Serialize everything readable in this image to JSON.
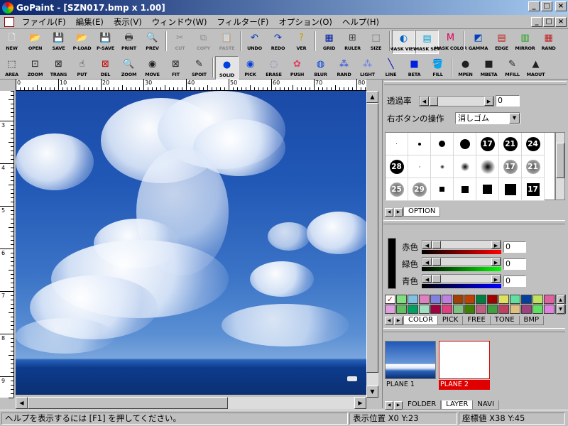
{
  "window": {
    "title": "GoPaint - [SZN017.bmp x 1.00]",
    "controls": {
      "minimize": "_",
      "maximize": "□",
      "close": "×"
    }
  },
  "menubar": {
    "items": [
      "ファイル(F)",
      "編集(E)",
      "表示(V)",
      "ウィンドウ(W)",
      "フィルター(F)",
      "オプション(O)",
      "ヘルプ(H)"
    ]
  },
  "toolbar1": {
    "groups": [
      [
        {
          "label": "NEW",
          "icon": "new-icon",
          "glyph": "🗋",
          "color": "#ffffff",
          "disabled": false
        },
        {
          "label": "OPEN",
          "icon": "open-icon",
          "glyph": "📂",
          "color": "#e0c040",
          "disabled": false
        },
        {
          "label": "SAVE",
          "icon": "save-icon",
          "glyph": "💾",
          "color": "#202020",
          "disabled": false
        },
        {
          "label": "P-LOAD",
          "icon": "palette-load-icon",
          "glyph": "📂",
          "color": "#e0c040",
          "disabled": false
        },
        {
          "label": "P-SAVE",
          "icon": "palette-save-icon",
          "glyph": "💾",
          "color": "#202020",
          "disabled": false
        },
        {
          "label": "PRINT",
          "icon": "print-icon",
          "glyph": "🖶",
          "color": "#404040",
          "disabled": false
        },
        {
          "label": "PREV",
          "icon": "preview-icon",
          "glyph": "🔍",
          "color": "#404040",
          "disabled": false
        }
      ],
      [
        {
          "label": "CUT",
          "icon": "cut-icon",
          "glyph": "✂",
          "color": "#404040",
          "disabled": true
        },
        {
          "label": "COPY",
          "icon": "copy-icon",
          "glyph": "⧉",
          "color": "#404040",
          "disabled": true
        },
        {
          "label": "PASTE",
          "icon": "paste-icon",
          "glyph": "📋",
          "color": "#404040",
          "disabled": true
        }
      ],
      [
        {
          "label": "UNDO",
          "icon": "undo-icon",
          "glyph": "↶",
          "color": "#0030c0",
          "disabled": false
        },
        {
          "label": "REDO",
          "icon": "redo-icon",
          "glyph": "↷",
          "color": "#0030c0",
          "disabled": false
        },
        {
          "label": "VER",
          "icon": "version-icon",
          "glyph": "?",
          "color": "#c0a000",
          "disabled": false
        }
      ],
      [
        {
          "label": "GRID",
          "icon": "grid-icon",
          "glyph": "▦",
          "color": "#0020a0",
          "disabled": false
        },
        {
          "label": "RULER",
          "icon": "ruler-icon",
          "glyph": "⊞",
          "color": "#404040",
          "disabled": false
        },
        {
          "label": "SIZE",
          "icon": "size-icon",
          "glyph": "⬚",
          "color": "#404040",
          "disabled": false
        }
      ],
      [
        {
          "label": "MASK VIEW",
          "icon": "mask-view-icon",
          "glyph": "◐",
          "color": "#0060c0",
          "disabled": false,
          "active": true
        },
        {
          "label": "MASK SET",
          "icon": "mask-set-icon",
          "glyph": "▤",
          "color": "#00a0d0",
          "disabled": false,
          "active": true
        },
        {
          "label": "MASK COLOR",
          "icon": "mask-color-icon",
          "glyph": "M",
          "color": "#e00060",
          "disabled": false
        }
      ],
      [
        {
          "label": "GAMMA",
          "icon": "gamma-icon",
          "glyph": "◩",
          "color": "#0040c0",
          "disabled": false
        },
        {
          "label": "EDGE",
          "icon": "edge-icon",
          "glyph": "▤",
          "color": "#c02020",
          "disabled": false
        },
        {
          "label": "MIRROR",
          "icon": "mirror-icon",
          "glyph": "▥",
          "color": "#20a020",
          "disabled": false
        },
        {
          "label": "RAND",
          "icon": "random-icon",
          "glyph": "▦",
          "color": "#c02020",
          "disabled": false
        }
      ]
    ]
  },
  "toolbar2": {
    "groups": [
      [
        {
          "label": "AREA",
          "icon": "area-select-icon",
          "glyph": "⬚",
          "color": "#202020"
        },
        {
          "label": "ZOOM",
          "icon": "zoom-area-icon",
          "glyph": "⊡",
          "color": "#202020"
        },
        {
          "label": "TRANS",
          "icon": "transform-icon",
          "glyph": "⊠",
          "color": "#202020"
        },
        {
          "label": "PUT",
          "icon": "put-icon",
          "glyph": "☝",
          "color": "#202020"
        },
        {
          "label": "DEL",
          "icon": "delete-icon",
          "glyph": "⊠",
          "color": "#c00000"
        },
        {
          "label": "ZOOM",
          "icon": "zoom-icon",
          "glyph": "🔍",
          "color": "#202020"
        },
        {
          "label": "MOVE",
          "icon": "move-icon",
          "glyph": "◉",
          "color": "#202020"
        },
        {
          "label": "FIT",
          "icon": "fit-icon",
          "glyph": "⊠",
          "color": "#202020"
        },
        {
          "label": "SPOIT",
          "icon": "eyedropper-icon",
          "glyph": "✎",
          "color": "#202020"
        }
      ],
      [
        {
          "label": "SOLID",
          "icon": "solid-brush-icon",
          "glyph": "●",
          "color": "#0040e0",
          "active": true
        },
        {
          "label": "PICK",
          "icon": "pick-brush-icon",
          "glyph": "◉",
          "color": "#0040e0"
        },
        {
          "label": "ERASE",
          "icon": "erase-brush-icon",
          "glyph": "◌",
          "color": "#6080c0"
        },
        {
          "label": "PUSH",
          "icon": "push-brush-icon",
          "glyph": "✿",
          "color": "#e04060"
        },
        {
          "label": "BLUR",
          "icon": "blur-brush-icon",
          "glyph": "◍",
          "color": "#0040e0"
        },
        {
          "label": "RAND",
          "icon": "random-brush-icon",
          "glyph": "⁂",
          "color": "#2040e0"
        },
        {
          "label": "LIGHT",
          "icon": "light-brush-icon",
          "glyph": "⁂",
          "color": "#6080e0"
        },
        {
          "label": "LINE",
          "icon": "line-icon",
          "glyph": "╲",
          "color": "#0000c0"
        },
        {
          "label": "BETA",
          "icon": "beta-fill-icon",
          "glyph": "■",
          "color": "#0020e0"
        },
        {
          "label": "FILL",
          "icon": "fill-icon",
          "glyph": "🪣",
          "color": "#0020a0"
        }
      ],
      [
        {
          "label": "MPEN",
          "icon": "mask-pen-icon",
          "glyph": "●",
          "color": "#202020"
        },
        {
          "label": "MBETA",
          "icon": "mask-beta-icon",
          "glyph": "■",
          "color": "#202020"
        },
        {
          "label": "MFILL",
          "icon": "mask-fill-icon",
          "glyph": "✎",
          "color": "#202020"
        },
        {
          "label": "MAOUT",
          "icon": "mask-out-icon",
          "glyph": "▲",
          "color": "#202020"
        }
      ]
    ]
  },
  "ruler": {
    "h_labels": [
      "0",
      "10",
      "20",
      "30",
      "40",
      "50",
      "60",
      "70",
      "80"
    ],
    "v_labels": [
      "3",
      "4",
      "5",
      "6",
      "7",
      "8",
      "9"
    ]
  },
  "brush_panel": {
    "opacity_label": "透過率",
    "opacity_value": "0",
    "right_button_label": "右ボタンの操作",
    "right_button_value": "消しゴム",
    "brushes": [
      {
        "kind": "dot",
        "size": 1
      },
      {
        "kind": "dot",
        "size": 4
      },
      {
        "kind": "dot",
        "size": 9
      },
      {
        "kind": "dot",
        "size": 14
      },
      {
        "kind": "numdot",
        "text": "17"
      },
      {
        "kind": "numdot",
        "text": "21"
      },
      {
        "kind": "numdot",
        "text": "24"
      },
      {
        "kind": "numdot",
        "text": "28"
      },
      {
        "kind": "soft",
        "size": 2
      },
      {
        "kind": "soft",
        "size": 6
      },
      {
        "kind": "soft",
        "size": 12
      },
      {
        "kind": "soft",
        "size": 20
      },
      {
        "kind": "softnum",
        "text": "17"
      },
      {
        "kind": "softnum",
        "text": "21"
      },
      {
        "kind": "softnum",
        "text": "25"
      },
      {
        "kind": "softnum",
        "text": "29"
      },
      {
        "kind": "sq",
        "size": 7
      },
      {
        "kind": "sq",
        "size": 10
      },
      {
        "kind": "sq",
        "size": 13
      },
      {
        "kind": "sq",
        "size": 16
      },
      {
        "kind": "sqnum",
        "text": "17"
      }
    ],
    "tabs": [
      "OPTION"
    ]
  },
  "color_panel": {
    "red_label": "赤色",
    "red_value": "0",
    "green_label": "緑色",
    "green_value": "0",
    "blue_label": "青色",
    "blue_value": "0",
    "current_color": "#000000",
    "palette": [
      "#c0c0c0",
      "#80e080",
      "#80c0e0",
      "#e080c0",
      "#8080e0",
      "#c080e0",
      "#a04000",
      "#c04000",
      "#008040",
      "#a00000",
      "#e0e060",
      "#60e0a0",
      "#0040a0",
      "#c0e060",
      "#e060a0",
      "#208060",
      "#e0a0e0",
      "#60c060",
      "#00a060",
      "#a0e0c0",
      "#a00040",
      "#e04080",
      "#80c080",
      "#408000",
      "#c06080",
      "#40a040",
      "#c04060",
      "#e0c080",
      "#a04080",
      "#60e060",
      "#e080e0",
      "#40c0a0"
    ],
    "tabs": [
      "COLOR",
      "PICK",
      "FREE",
      "TONE",
      "BMP"
    ]
  },
  "layer_panel": {
    "layers": [
      {
        "name": "PLANE 1",
        "selected": false
      },
      {
        "name": "PLANE 2",
        "selected": true
      }
    ],
    "tabs": [
      "FOLDER",
      "LAYER",
      "NAVI"
    ]
  },
  "statusbar": {
    "help_text": "ヘルプを表示するには [F1] を押してください。",
    "position_label": "表示位置 X0 Y:23",
    "coord_label": "座標値 X38 Y:45"
  }
}
